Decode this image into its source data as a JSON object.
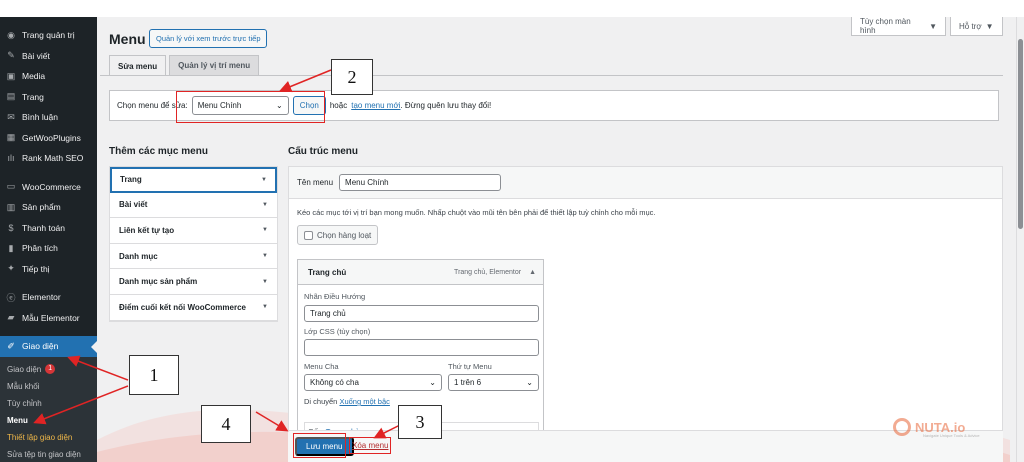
{
  "topbar": {
    "screen_options": "Tùy chọn màn hình",
    "help": "Hỗ trợ"
  },
  "sidebar": {
    "items": [
      {
        "label": "Trang quản trị",
        "icon": "dashboard-icon",
        "glyph": "◉"
      },
      {
        "label": "Bài viết",
        "icon": "pin-icon",
        "glyph": "✎"
      },
      {
        "label": "Media",
        "icon": "media-icon",
        "glyph": "▣"
      },
      {
        "label": "Trang",
        "icon": "page-icon",
        "glyph": "▤"
      },
      {
        "label": "Bình luận",
        "icon": "comment-icon",
        "glyph": "✉"
      },
      {
        "label": "GetWooPlugins",
        "icon": "plugin-box-icon",
        "glyph": "▦"
      },
      {
        "label": "Rank Math SEO",
        "icon": "chart-icon",
        "glyph": "ılı"
      },
      {
        "label": "WooCommerce",
        "icon": "woo-icon",
        "glyph": "▭"
      },
      {
        "label": "Sản phẩm",
        "icon": "product-icon",
        "glyph": "▥"
      },
      {
        "label": "Thanh toán",
        "icon": "payment-icon",
        "glyph": "$"
      },
      {
        "label": "Phân tích",
        "icon": "analytics-icon",
        "glyph": "▮"
      },
      {
        "label": "Tiếp thị",
        "icon": "marketing-icon",
        "glyph": "✦"
      },
      {
        "label": "Elementor",
        "icon": "elementor-icon",
        "glyph": "ⓔ"
      },
      {
        "label": "Mẫu Elementor",
        "icon": "folder-icon",
        "glyph": "▰"
      },
      {
        "label": "Giao diện",
        "icon": "brush-icon",
        "glyph": "✐"
      }
    ],
    "submenu": [
      {
        "label": "Giao diện",
        "badge": "1"
      },
      {
        "label": "Mẫu khối"
      },
      {
        "label": "Tùy chỉnh"
      },
      {
        "label": "Menu"
      },
      {
        "label": "Thiết lập giao diện"
      },
      {
        "label": "Sửa tệp tin giao diện"
      }
    ]
  },
  "header": {
    "title": "Menu",
    "preview_button": "Quản lý với xem trước trực tiếp"
  },
  "tabs": [
    {
      "label": "Sửa menu"
    },
    {
      "label": "Quản lý vị trí menu"
    }
  ],
  "select_menu": {
    "label": "Chọn menu để sửa:",
    "selected": "Menu Chính",
    "button": "Chọn",
    "or_text": "hoặc",
    "create_link": "tạo menu mới",
    "reminder": ". Đừng quên lưu thay đổi!"
  },
  "add_items": {
    "title": "Thêm các mục menu",
    "sections": [
      "Trang",
      "Bài viết",
      "Liên kết tự tạo",
      "Danh mục",
      "Danh mục sản phẩm",
      "Điểm cuối kết nối WooCommerce"
    ]
  },
  "structure": {
    "title": "Cấu trúc menu",
    "name_label": "Tên menu",
    "name_value": "Menu Chính",
    "instructions": "Kéo các mục tới vị trí bạn mong muốn. Nhấp chuột vào mũi tên bên phải để thiết lập tuỳ chỉnh cho mỗi mục.",
    "bulk_select": "Chọn hàng loạt",
    "item": {
      "title": "Trang chủ",
      "meta": "Trang chủ, Elementor",
      "nav_label_label": "Nhãn Điều Hướng",
      "nav_label_value": "Trang chủ",
      "css_label": "Lớp CSS (tùy chọn)",
      "css_value": "",
      "parent_label": "Menu Cha",
      "parent_value": "Không có cha",
      "order_label": "Thứ tự Menu",
      "order_value": "1 trên 6",
      "move_label": "Di chuyển",
      "move_link": "Xuống một bậc",
      "original_label": "Gốc:",
      "original_link": "Trang chủ"
    }
  },
  "footer": {
    "save": "Lưu menu",
    "delete": "Xóa menu"
  },
  "annotations": [
    "1",
    "2",
    "3",
    "4"
  ],
  "colors": {
    "accent": "#2271b1",
    "sidebar": "#1d2327",
    "annotation": "#e02424",
    "danger": "#b32d2e"
  },
  "watermark": {
    "brand": "NUTA.io",
    "tagline": "Navigate Unique Tools & Advice"
  }
}
